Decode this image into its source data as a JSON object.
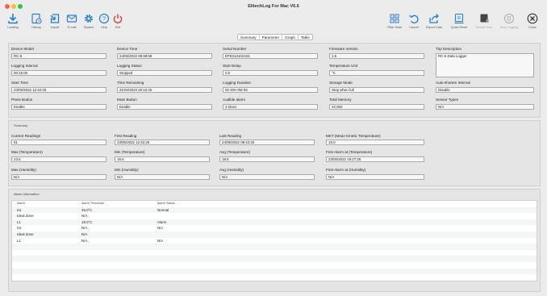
{
  "window": {
    "title": "ElitechLog For Mac V6.6"
  },
  "toolbar": {
    "left": [
      {
        "label": "Loading",
        "icon": "download-icon"
      },
      {
        "label": "History",
        "icon": "history-icon"
      },
      {
        "label": "Import",
        "icon": "import-icon"
      },
      {
        "label": "E-mail",
        "icon": "mail-icon"
      },
      {
        "label": "System",
        "icon": "gear-icon"
      },
      {
        "label": "Help",
        "icon": "help-icon"
      },
      {
        "label": "Exit",
        "icon": "power-icon"
      }
    ],
    "right": [
      {
        "label": "Filter Data",
        "icon": "grid-icon",
        "enabled": true
      },
      {
        "label": "Cancel",
        "icon": "undo-icon",
        "enabled": true
      },
      {
        "label": "Export Data",
        "icon": "export-icon",
        "enabled": true
      },
      {
        "label": "Quick Reset",
        "icon": "reset-icon",
        "enabled": true
      },
      {
        "label": "Disable data",
        "icon": "square-icon",
        "enabled": false
      },
      {
        "label": "Stop Logging",
        "icon": "stop-icon",
        "enabled": false
      },
      {
        "label": "Close",
        "icon": "close-icon",
        "enabled": true
      }
    ],
    "accent": "#1f7fd6"
  },
  "tabs": [
    "Summary",
    "Parameter",
    "Graph",
    "Table"
  ],
  "active_tab": "Summary",
  "info": {
    "device_model": {
      "label": "Device Model",
      "value": "RC-5"
    },
    "device_time": {
      "label": "Device Time",
      "value": "24/05/2022 09:38:58"
    },
    "serial_number": {
      "label": "Serial Number",
      "value": "EFE313102422"
    },
    "firmware_version": {
      "label": "Firmware Version",
      "value": "1.5"
    },
    "trip_description": {
      "label": "Trip Description",
      "value": "RC-5 Data Logger"
    },
    "logging_interval": {
      "label": "Logging Interval",
      "value": "00:15:00"
    },
    "logging_status": {
      "label": "Logging Status",
      "value": "Stopped"
    },
    "start_delay": {
      "label": "Start Delay",
      "value": "0.0"
    },
    "temperature_unit": {
      "label": "Temperature Unit",
      "value": "°C"
    },
    "start_time": {
      "label": "Start Time",
      "value": "23/05/2022 12:42:25"
    },
    "time_remaining": {
      "label": "Time Remaining",
      "value": "21/04/2023 20:42:25"
    },
    "logging_duration": {
      "label": "Logging Duration",
      "value": "00 20H 0M 0S"
    },
    "storage_mode": {
      "label": "Storage Mode",
      "value": "Stop when full"
    },
    "auto_shorten": {
      "label": "Auto-shorten Interval",
      "value": "Disable"
    },
    "press_button": {
      "label": "Press Button",
      "value": "Enable"
    },
    "mute_button": {
      "label": "Mute Button",
      "value": "Enable"
    },
    "audible_alarm": {
      "label": "Audible alarm",
      "value": "3 times"
    },
    "total_memory": {
      "label": "Total Memory",
      "value": "32,000"
    },
    "sensor_types": {
      "label": "Sensor Types",
      "value": "N/A"
    }
  },
  "summary": {
    "title": "Summary",
    "current_readings": {
      "label": "Current Readings",
      "value": "81"
    },
    "first_reading": {
      "label": "First Reading",
      "value": "23/05/2022 12:42:25"
    },
    "last_reading": {
      "label": "Last Reading",
      "value": "24/05/2022 08:42:25"
    },
    "mkt": {
      "label": "MKT (Mean Kinetic Temperature)",
      "value": "19.0"
    },
    "max_temp": {
      "label": "Max (Temperature)",
      "value": "23.5"
    },
    "min_temp": {
      "label": "Min (Temperature)",
      "value": "16.5"
    },
    "avg_temp": {
      "label": "Avg (Temperature)",
      "value": "18.6"
    },
    "first_alarm_temp": {
      "label": "First Alarm at (Temperature)",
      "value": "23/05/2022 19:27:25"
    },
    "max_humidity": {
      "label": "Max (Humidity)",
      "value": "N/A"
    },
    "min_humidity": {
      "label": "Min (Humidity)",
      "value": "N/A"
    },
    "avg_humidity": {
      "label": "Avg (Humidity)",
      "value": "N/A"
    },
    "first_alarm_humidity": {
      "label": "First Alarm at (Humidity)",
      "value": "N/A"
    }
  },
  "alarm": {
    "title": "Alarm Information",
    "columns": [
      "Alarm",
      "Alarm Threshold",
      "Alarm Status"
    ],
    "rows": [
      [
        "H1",
        "25.0°C",
        "Normal"
      ],
      [
        "Ideal Zone",
        "N/A",
        ""
      ],
      [
        "L1",
        "18.0°C",
        "Alarm"
      ],
      [
        "H1",
        "N/A",
        "N/A"
      ],
      [
        "Ideal Zone",
        "N/A",
        ""
      ],
      [
        "L1",
        "N/A",
        "N/A"
      ],
      [
        "",
        "",
        ""
      ],
      [
        "",
        "",
        ""
      ],
      [
        "",
        "",
        ""
      ],
      [
        "",
        "",
        ""
      ],
      [
        "",
        "",
        ""
      ],
      [
        "",
        "",
        ""
      ]
    ]
  }
}
